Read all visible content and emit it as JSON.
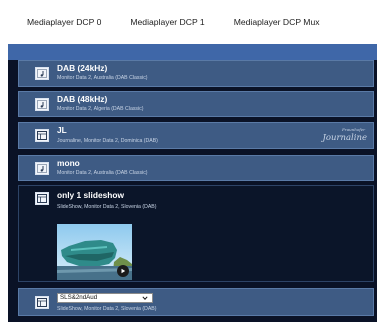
{
  "tabs": [
    "Mediaplayer DCP 0",
    "Mediaplayer DCP 1",
    "Mediaplayer DCP Mux"
  ],
  "colors": {
    "frame_bg": "#0a1226",
    "topbar": "#3f67a8",
    "item_bg": "#3e5b84",
    "item_dark_bg": "#0b1529"
  },
  "items": [
    {
      "title": "DAB (24kHz)",
      "subtitle": "Monitor Data 2, Australia (DAB Classic)",
      "icon": "audio-file-icon"
    },
    {
      "title": "DAB (48kHz)",
      "subtitle": "Monitor Data 2, Algeria (DAB Classic)",
      "icon": "audio-file-icon"
    },
    {
      "title": "JL",
      "subtitle": "Journaline, Monitor Data 2, Dominica (DAB)",
      "icon": "slideshow-icon",
      "logo_line1": "Fraunhofer",
      "logo_line2": "Journaline"
    },
    {
      "title": "mono",
      "subtitle": "Monitor Data 2, Australia (DAB Classic)",
      "icon": "audio-file-icon"
    },
    {
      "title": "only 1 slideshow",
      "subtitle": "SlideShow, Monitor Data 2, Slovenia (DAB)",
      "icon": "slideshow-icon"
    },
    {
      "select_value": "SLS&2ndAud",
      "subtitle": "SlideShow, Monitor Data 2, Slovenia (DAB)",
      "icon": "slideshow-icon"
    }
  ]
}
